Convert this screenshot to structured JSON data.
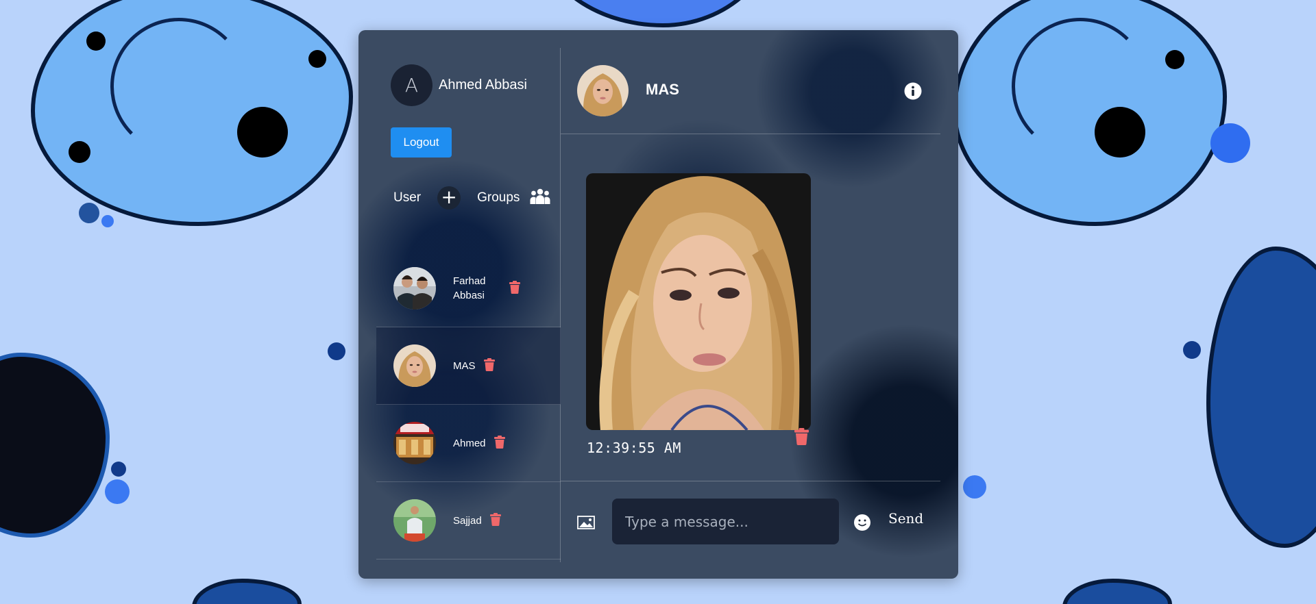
{
  "user": {
    "initial": "A",
    "name": "Ahmed Abbasi"
  },
  "logout_label": "Logout",
  "tabs": {
    "user": "User",
    "groups": "Groups"
  },
  "contacts": [
    {
      "name": "Farhad Abbasi",
      "active": false
    },
    {
      "name": "MAS",
      "active": true
    },
    {
      "name": "Ahmed",
      "active": false
    },
    {
      "name": "Sajjad",
      "active": false
    }
  ],
  "chat": {
    "name": "MAS",
    "message_time": "12:39:55 AM",
    "input_placeholder": "Type a message...",
    "send_label": "Send"
  },
  "colors": {
    "accent": "#1f8ef1",
    "trash": "#f0686a",
    "background": "#b9d3fb"
  }
}
